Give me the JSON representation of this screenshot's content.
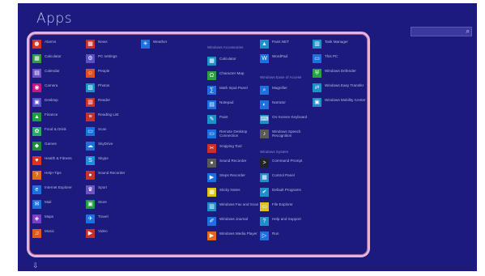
{
  "page": {
    "title": "Apps"
  },
  "search": {
    "icon": "search-icon"
  },
  "nav": {
    "down_arrow": "⇩"
  },
  "columns": [
    [
      {
        "label": "Alarms",
        "color": "#e0301e",
        "glyph": "⏰"
      },
      {
        "label": "Calculator",
        "color": "#2ea043",
        "glyph": "▦"
      },
      {
        "label": "Calendar",
        "color": "#6b52c9",
        "glyph": "▤"
      },
      {
        "label": "Camera",
        "color": "#c71585",
        "glyph": "◉"
      },
      {
        "label": "Desktop",
        "color": "#5a4fc9",
        "glyph": "▣"
      },
      {
        "label": "Finance",
        "color": "#1e9e3e",
        "glyph": "▲"
      },
      {
        "label": "Food & Drink",
        "color": "#2ea86a",
        "glyph": "✿"
      },
      {
        "label": "Games",
        "color": "#1f8c3a",
        "glyph": "◆"
      },
      {
        "label": "Health & Fitness",
        "color": "#e0301e",
        "glyph": "♥"
      },
      {
        "label": "Help+Tips",
        "color": "#e06a1e",
        "glyph": "?"
      },
      {
        "label": "Internet Explorer",
        "color": "#1e6fe0",
        "glyph": "e"
      },
      {
        "label": "Mail",
        "color": "#1e6fe0",
        "glyph": "✉"
      },
      {
        "label": "Maps",
        "color": "#7a3fc9",
        "glyph": "◈"
      },
      {
        "label": "Music",
        "color": "#e05a1e",
        "glyph": "♫"
      }
    ],
    [
      {
        "label": "News",
        "color": "#c9302c",
        "glyph": "▦"
      },
      {
        "label": "PC settings",
        "color": "#5a4fc9",
        "glyph": "⚙"
      },
      {
        "label": "People",
        "color": "#e0501e",
        "glyph": "☺"
      },
      {
        "label": "Photos",
        "color": "#1e8fc9",
        "glyph": "▨"
      },
      {
        "label": "Reader",
        "color": "#c9302c",
        "glyph": "▥"
      },
      {
        "label": "Reading List",
        "color": "#c9302c",
        "glyph": "≡"
      },
      {
        "label": "Scan",
        "color": "#1e6fe0",
        "glyph": "▭"
      },
      {
        "label": "SkyDrive",
        "color": "#1e6fe0",
        "glyph": "☁"
      },
      {
        "label": "Skype",
        "color": "#1e8fe0",
        "glyph": "S"
      },
      {
        "label": "Sound Recorder",
        "color": "#c9302c",
        "glyph": "●"
      },
      {
        "label": "Sport",
        "color": "#6b52c9",
        "glyph": "♛"
      },
      {
        "label": "Store",
        "color": "#1e9e3e",
        "glyph": "▣"
      },
      {
        "label": "Travel",
        "color": "#1e6fe0",
        "glyph": "✈"
      },
      {
        "label": "Video",
        "color": "#c9302c",
        "glyph": "▶"
      }
    ],
    [
      {
        "label": "Weather",
        "color": "#1e6fe0",
        "glyph": "☀"
      }
    ],
    [
      {
        "label": "Calculator",
        "color": "#1e8fc9",
        "glyph": "▦"
      },
      {
        "label": "Character Map",
        "color": "#2ea043",
        "glyph": "Ω"
      },
      {
        "label": "Math Input Panel",
        "color": "#1e6fe0",
        "glyph": "∑"
      },
      {
        "label": "Notepad",
        "color": "#1e6fe0",
        "glyph": "▤"
      },
      {
        "label": "Paint",
        "color": "#1e8fc9",
        "glyph": "✎"
      },
      {
        "label": "Remote Desktop Connection",
        "color": "#1e6fe0",
        "glyph": "▭"
      },
      {
        "label": "Snipping Tool",
        "color": "#c9302c",
        "glyph": "✂"
      },
      {
        "label": "Sound Recorder",
        "color": "#5a5a5a",
        "glyph": "●"
      },
      {
        "label": "Steps Recorder",
        "color": "#1e6fe0",
        "glyph": "▶"
      },
      {
        "label": "Sticky Notes",
        "color": "#e0c21e",
        "glyph": "▩"
      },
      {
        "label": "Windows Fax and Scan",
        "color": "#1e8fc9",
        "glyph": "▥"
      },
      {
        "label": "Windows Journal",
        "color": "#1e6fe0",
        "glyph": "✐"
      },
      {
        "label": "Windows Media Player",
        "color": "#e06a1e",
        "glyph": "▶"
      }
    ],
    [
      {
        "label": "Paint.NET",
        "color": "#1e8fc9",
        "glyph": "▲"
      },
      {
        "label": "WordPad",
        "color": "#1e6fe0",
        "glyph": "W"
      },
      {
        "label": "Magnifier",
        "color": "#1e6fe0",
        "glyph": "⌕"
      },
      {
        "label": "Narrator",
        "color": "#1e6fe0",
        "glyph": "◐"
      },
      {
        "label": "On-Screen Keyboard",
        "color": "#1e8fc9",
        "glyph": "⌨"
      },
      {
        "label": "Windows Speech Recognition",
        "color": "#5a5a5a",
        "glyph": "♪"
      },
      {
        "label": "Command Prompt",
        "color": "#222222",
        "glyph": ">"
      },
      {
        "label": "Control Panel",
        "color": "#1e8fc9",
        "glyph": "▦"
      },
      {
        "label": "Default Programs",
        "color": "#1e8fc9",
        "glyph": "✔"
      },
      {
        "label": "File Explorer",
        "color": "#e0c21e",
        "glyph": "▭"
      },
      {
        "label": "Help and Support",
        "color": "#1e8fc9",
        "glyph": "?"
      },
      {
        "label": "Run",
        "color": "#1e6fe0",
        "glyph": "▷"
      }
    ],
    [
      {
        "label": "Task Manager",
        "color": "#1e8fc9",
        "glyph": "▥"
      },
      {
        "label": "This PC",
        "color": "#1e6fe0",
        "glyph": "▭"
      },
      {
        "label": "Windows Defender",
        "color": "#2ea043",
        "glyph": "⛨"
      },
      {
        "label": "Windows Easy Transfer",
        "color": "#1e8fc9",
        "glyph": "⇄"
      },
      {
        "label": "Windows Mobility Center",
        "color": "#1e8fc9",
        "glyph": "▣"
      }
    ]
  ],
  "group_headers": [
    {
      "label": "Windows Accessories"
    },
    {
      "label": "Windows Ease of Access"
    },
    {
      "label": "Windows System"
    }
  ]
}
